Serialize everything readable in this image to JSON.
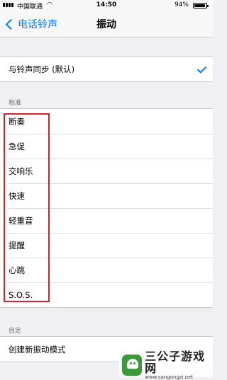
{
  "status_bar": {
    "carrier": "中国联通",
    "time": "14:50",
    "battery_text": "94%",
    "battery_level": 0.94
  },
  "nav": {
    "back_label": "电话铃声",
    "title": "振动"
  },
  "sync_row": {
    "label": "与铃声同步 (默认)",
    "selected": true
  },
  "standard_section": {
    "header": "标准",
    "items": [
      "断奏",
      "急促",
      "交响乐",
      "快速",
      "轻重音",
      "提醒",
      "心跳",
      "S.O.S."
    ]
  },
  "custom_section": {
    "header": "自定",
    "create_label": "创建新振动模式"
  },
  "watermark": {
    "title": "三公子游戏网",
    "url": "www.sangongzi.net"
  },
  "colors": {
    "accent": "#007aff",
    "annotation": "#d81e2a",
    "background": "#efeff4"
  }
}
